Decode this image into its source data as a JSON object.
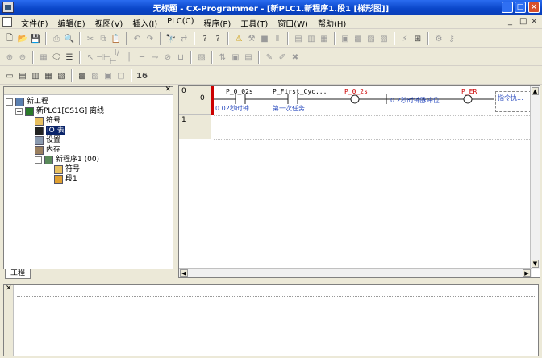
{
  "title": "无标题 - CX-Programmer - [新PLC1.新程序1.段1 [梯形图]]",
  "menu": [
    "文件(F)",
    "编辑(E)",
    "视图(V)",
    "插入(I)",
    "PLC(C)",
    "程序(P)",
    "工具(T)",
    "窗口(W)",
    "帮助(H)"
  ],
  "window_controls": {
    "minimize": "_",
    "maximize": "□",
    "close": "×"
  },
  "tree": {
    "root": "新工程",
    "plc": "新PLC1[CS1G] 离线",
    "symbols": "符号",
    "io_table": "IO 表",
    "settings": "设置",
    "memory": "内存",
    "program": "新程序1 (00)",
    "prog_symbols": "符号",
    "section": "段1"
  },
  "tab_label": "工程",
  "ladder": {
    "rung0_num": "0",
    "rung0_step": "0",
    "rung1_num": "1",
    "contacts": [
      {
        "label": "P_0_02s",
        "comment": "0.02秒时钟..."
      },
      {
        "label": "P_First_Cyc...",
        "comment": "第一次任务..."
      }
    ],
    "coils": [
      {
        "label": "P_0_2s",
        "comment": "0.2秒时钟脉冲位"
      },
      {
        "label": "P_ER",
        "comment": ""
      }
    ],
    "instruction_box": "指令执..."
  },
  "toolbar3_label": "16"
}
